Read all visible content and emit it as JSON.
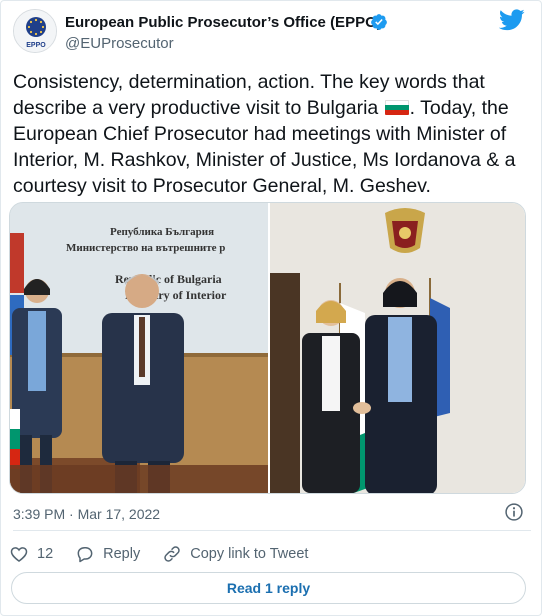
{
  "author": {
    "name": "European Public Prosecutor’s Office (EPPO)",
    "handle": "@EUProsecutor",
    "avatar_icon": "eppo-logo-icon",
    "avatar_text": "EPPO",
    "verified_icon": "verified-badge-icon"
  },
  "platform_icon": "twitter-bird-icon",
  "tweet": {
    "text_before_flag": "Consistency, determination, action. The key words that describe a very productive visit to Bulgaria ",
    "flag_icon": "bulgaria-flag-icon",
    "text_after_flag": ". Today, the European Chief Prosecutor had meetings with Minister of Interior, M. Rashkov, Minister of Justice, Ms Iordanova & a courtesy visit to Prosecutor General, M. Geshev."
  },
  "media": {
    "left_photo": {
      "sign_line1": "Република България",
      "sign_line2": "Министерство на вътрешните р",
      "sign_line3": "Republic of Bulgaria",
      "sign_line4": "Ministry of Interior"
    },
    "right_photo": {
      "coat_of_arms_icon": "coat-of-arms-icon"
    }
  },
  "timestamp": "3:39 PM · Mar 17, 2022",
  "info_icon": "info-icon",
  "actions": {
    "like_count": "12",
    "reply_label": "Reply",
    "copy_link_label": "Copy link to Tweet"
  },
  "read_replies_label": "Read 1 reply",
  "colors": {
    "twitter_blue": "#1d9bf0",
    "link_blue": "#1b6fb0",
    "secondary_text": "#536471",
    "flag_white": "#ffffff",
    "flag_green": "#00966e",
    "flag_red": "#d62612"
  }
}
